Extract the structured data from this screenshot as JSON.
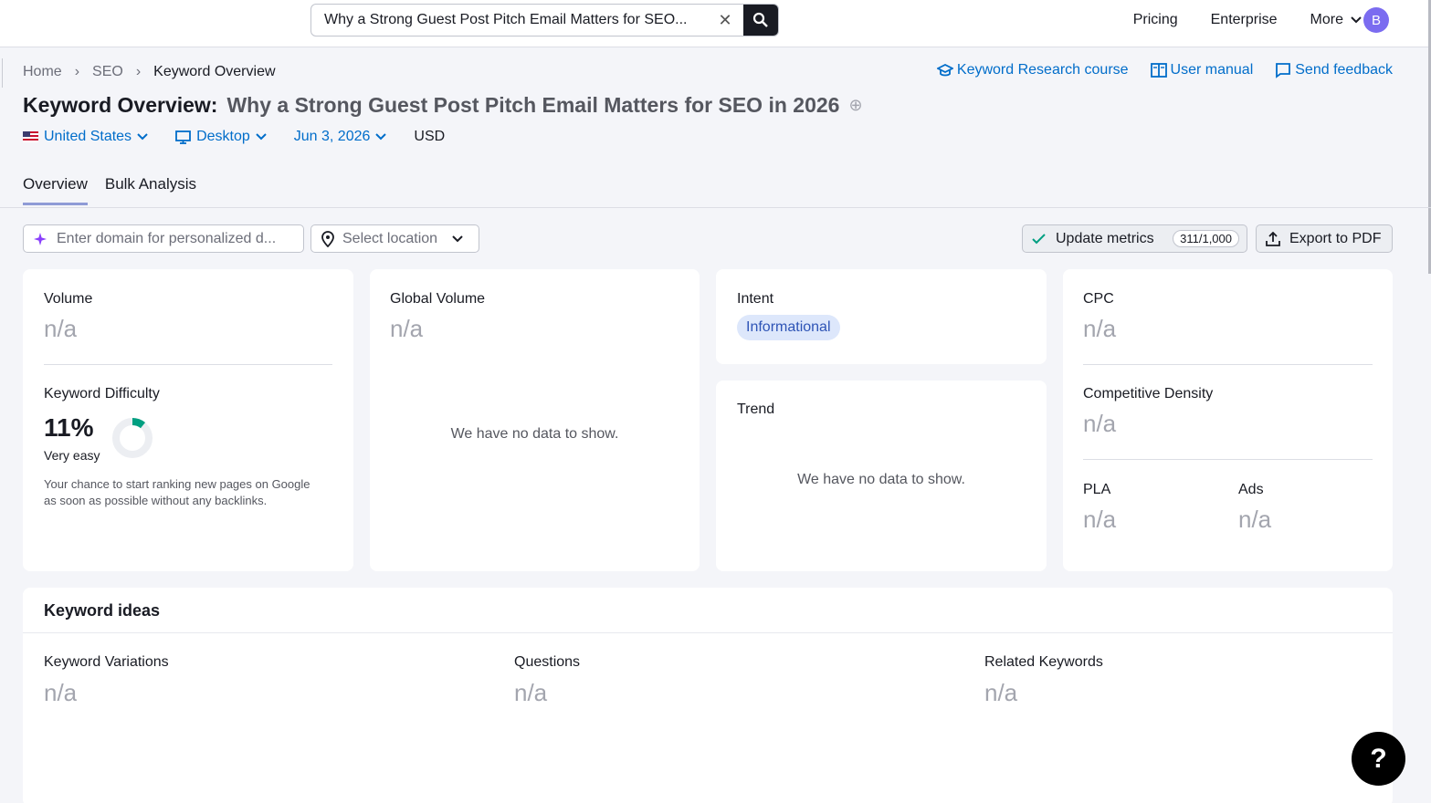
{
  "search": {
    "query": "Why a Strong Guest Post Pitch Email Matters for SEO..."
  },
  "topnav": {
    "pricing": "Pricing",
    "enterprise": "Enterprise",
    "more": "More",
    "avatar": "B"
  },
  "breadcrumb": {
    "home": "Home",
    "seo": "SEO",
    "current": "Keyword Overview"
  },
  "links": {
    "course": "Keyword Research course",
    "manual": "User manual",
    "feedback": "Send feedback"
  },
  "header": {
    "prefix": "Keyword Overview:",
    "keyword": "Why a Strong Guest Post Pitch Email Matters for SEO in 2026"
  },
  "filters": {
    "country": "United States",
    "device": "Desktop",
    "date": "Jun 3, 2026",
    "currency": "USD"
  },
  "tabs": [
    {
      "label": "Overview"
    },
    {
      "label": "Bulk Analysis"
    }
  ],
  "controls": {
    "domain_placeholder": "Enter domain for personalized d...",
    "location_placeholder": "Select location",
    "update_label": "Update metrics",
    "update_count": "311/1,000",
    "export_label": "Export to PDF"
  },
  "metrics": {
    "volume": {
      "label": "Volume",
      "value": "n/a"
    },
    "kd": {
      "label": "Keyword Difficulty",
      "value": "11%",
      "percent": 11,
      "level": "Very easy",
      "description": "Your chance to start ranking new pages on Google as soon as possible without any backlinks."
    },
    "global_volume": {
      "label": "Global Volume",
      "value": "n/a",
      "empty": "We have no data to show."
    },
    "intent": {
      "label": "Intent",
      "value": "Informational"
    },
    "trend": {
      "label": "Trend",
      "empty": "We have no data to show."
    },
    "cpc": {
      "label": "CPC",
      "value": "n/a"
    },
    "density": {
      "label": "Competitive Density",
      "value": "n/a"
    },
    "pla": {
      "label": "PLA",
      "value": "n/a"
    },
    "ads": {
      "label": "Ads",
      "value": "n/a"
    }
  },
  "ideas": {
    "title": "Keyword ideas",
    "variations": {
      "label": "Keyword Variations",
      "value": "n/a"
    },
    "questions": {
      "label": "Questions",
      "value": "n/a"
    },
    "related": {
      "label": "Related Keywords",
      "value": "n/a"
    }
  },
  "help": "?",
  "colors": {
    "link": "#006dca",
    "kd_green": "#009f81",
    "intent_bg": "#dde7fb"
  }
}
